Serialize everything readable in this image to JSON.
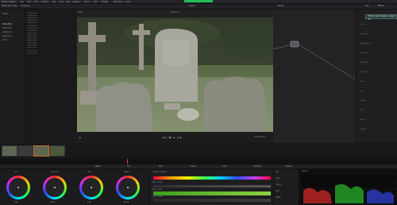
{
  "topbar": {
    "menu": [
      "DaVinci Resolve",
      "File",
      "Edit",
      "Trim",
      "Timeline",
      "Clip",
      "Mark",
      "View",
      "Playback",
      "Fusion",
      "Color",
      "Fairlight",
      "Workspace",
      "Help"
    ],
    "title": "Project",
    "accent": "#e4572e"
  },
  "toolbar": {
    "left": [
      "Media Pool",
      "Clips",
      "Timelines"
    ],
    "center": "Grade",
    "right": [
      "Nodes",
      "Clip",
      "Effects"
    ]
  },
  "sidebar": {
    "items": [
      {
        "label": "Master",
        "active": false
      },
      {
        "label": "Power Bins",
        "active": true
      },
      {
        "label": "Smart Bins",
        "active": false
      },
      {
        "label": "Collections",
        "active": false
      },
      {
        "label": "Keywords",
        "active": false
      },
      {
        "label": "Faces",
        "active": false
      }
    ]
  },
  "media_list": {
    "rows": [
      "Clip 001.mov",
      "Clip 002.mov",
      "Clip 003.mov",
      "Clip 004.mov",
      "Clip 005.mov",
      "Clip 006.mov",
      "Clip 007.mov",
      "Clip 008.mov",
      "Clip 009.mov",
      "Clip 010.mov",
      "Clip 011.mov",
      "Clip 012.mov",
      "Clip 013.mov",
      "Clip 014.mov",
      "Clip 015.mov",
      "Clip 016.mov",
      "Clip 017.mov"
    ]
  },
  "viewer": {
    "title": "Timeline 1",
    "zoom": "100%",
    "timecode": "01:00:12:08"
  },
  "tooltip": "Edit or Learn Clues ↓ Pennil B...",
  "right_panel": {
    "items": [
      "Color",
      "Grading",
      "Magic Mask",
      "Qualifier",
      "Window",
      "Tracker",
      "Blur",
      "Key",
      "Sizing",
      "3D",
      "Stills",
      "Gallery"
    ]
  },
  "nav": [
    "Media",
    "Cut",
    "Edit",
    "Fusion",
    "Color",
    "Fairlight",
    "Deliver"
  ],
  "wheels": {
    "labels": [
      "Lift",
      "Gamma",
      "Gain",
      "Offset"
    ],
    "values": [
      "0.00",
      "0.00",
      "1.00",
      "25.00"
    ]
  },
  "curves": {
    "title": "Curves - Custom",
    "tabs": [
      "Hue vs Hue",
      "Hue vs Sat",
      "Lum vs Sat"
    ]
  },
  "keys": {
    "title": "Key",
    "rows": [
      "Input",
      "Output",
      "Gain",
      "Offset"
    ]
  },
  "scopes": {
    "title": "Parade",
    "ticks": [
      "1023",
      "896",
      "768",
      "640",
      "512",
      "384",
      "256",
      "128",
      "0"
    ]
  }
}
